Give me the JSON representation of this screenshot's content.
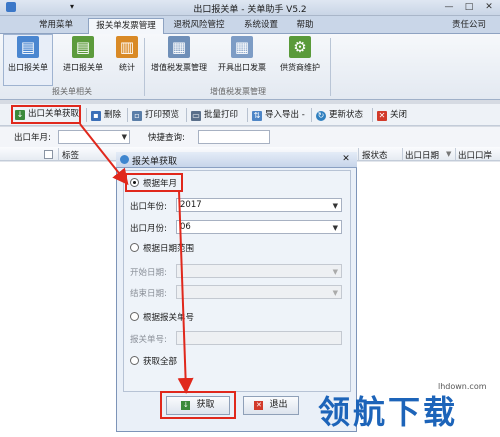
{
  "window": {
    "title": "出口报关单 - 关单助手 V5.2",
    "qa_icon": "▾",
    "minimize": "—",
    "maximize": "□",
    "close": "✕"
  },
  "tabs": [
    {
      "label": "常用菜单"
    },
    {
      "label": "报关单发票管理"
    },
    {
      "label": "退税风险管控"
    },
    {
      "label": "系统设置"
    },
    {
      "label": "帮助"
    }
  ],
  "company": "责任公司",
  "ribbon": {
    "groups": [
      {
        "label": "报关单相关"
      },
      {
        "label": "增值税发票管理"
      }
    ],
    "buttons": [
      {
        "label": "出口报关单",
        "icon": "document-icon"
      },
      {
        "label": "进口报关单",
        "icon": "document-icon"
      },
      {
        "label": "统计",
        "icon": "bar-chart-icon"
      },
      {
        "label": "增值税发票管理",
        "icon": "invoice-icon"
      },
      {
        "label": "开具出口发票",
        "icon": "invoice-icon"
      },
      {
        "label": "供货商维护",
        "icon": "user-gear-icon"
      }
    ]
  },
  "toolbar": {
    "items": [
      {
        "label": "出口关单获取"
      },
      {
        "label": "删除"
      },
      {
        "label": "打印预览"
      },
      {
        "label": "批量打印"
      },
      {
        "label": "导入导出 -"
      },
      {
        "label": "更新状态"
      },
      {
        "label": "关闭"
      }
    ]
  },
  "filter": {
    "year_label": "出口年月:",
    "year_value": "",
    "search_label": "快捷查询:",
    "search_value": ""
  },
  "grid": {
    "columns": [
      {
        "label": "标签"
      },
      {
        "label": "报状态"
      },
      {
        "label": "出口日期"
      },
      {
        "label": "出口口岸"
      }
    ]
  },
  "dialog": {
    "title": "报关单获取",
    "close": "✕",
    "by_month": {
      "label": "根据年月",
      "year_label": "出口年份:",
      "year_value": "2017",
      "month_label": "出口月份:",
      "month_value": "06"
    },
    "by_range": {
      "label": "根据日期范围",
      "start_label": "开始日期:",
      "start_value": "",
      "end_label": "结束日期:",
      "end_value": ""
    },
    "by_number": {
      "label": "根据报关单号",
      "number_label": "报关单号:",
      "number_value": ""
    },
    "all": {
      "label": "获取全部"
    },
    "selected": "by_month",
    "fetch_label": "获取",
    "exit_label": "退出"
  },
  "watermark": {
    "site": "lhdown.com",
    "brand": "领航下载"
  },
  "colors": {
    "highlight": "#e0281c",
    "accent": "#2f6fc2"
  }
}
